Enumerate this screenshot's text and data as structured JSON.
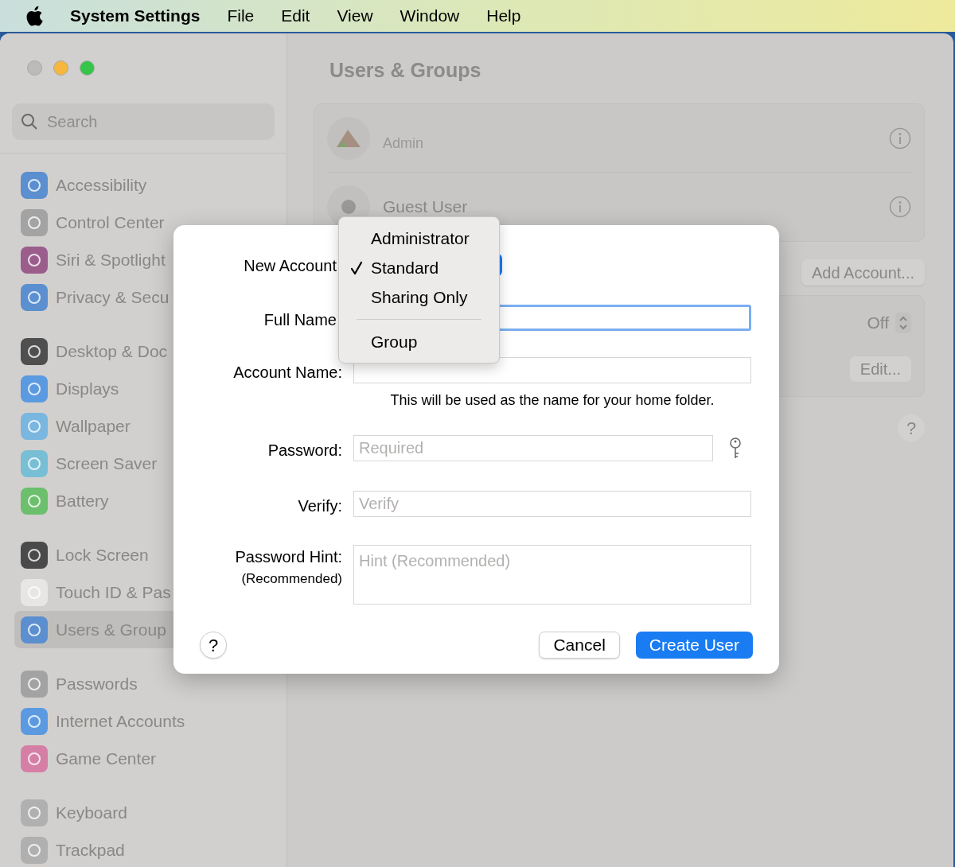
{
  "menu_bar": {
    "app": "System Settings",
    "menus": [
      "File",
      "Edit",
      "View",
      "Window",
      "Help"
    ]
  },
  "sidebar": {
    "search": {
      "placeholder": "Search"
    },
    "groups": [
      [
        {
          "label": "Accessibility",
          "color": "#5b8fcf",
          "selected": false
        },
        {
          "label": "Control Center",
          "color": "#a3a3a3",
          "selected": false
        },
        {
          "label": "Siri & Spotlight",
          "color": "#9b5d8c",
          "selected": false
        },
        {
          "label": "Privacy & Secu",
          "color": "#5b8fcf",
          "selected": false
        }
      ],
      [
        {
          "label": "Desktop & Doc",
          "color": "#4f4f4f",
          "selected": false
        },
        {
          "label": "Displays",
          "color": "#5b9ae0",
          "selected": false
        },
        {
          "label": "Wallpaper",
          "color": "#79b6e0",
          "selected": false
        },
        {
          "label": "Screen Saver",
          "color": "#78bfd6",
          "selected": false
        },
        {
          "label": "Battery",
          "color": "#6cbf6c",
          "selected": false
        }
      ],
      [
        {
          "label": "Lock Screen",
          "color": "#4a4a4a",
          "selected": false
        },
        {
          "label": "Touch ID & Pas",
          "color": "#e8e6e4",
          "selected": false
        },
        {
          "label": "Users & Group",
          "color": "#5b8fcf",
          "selected": true
        }
      ],
      [
        {
          "label": "Passwords",
          "color": "#a3a3a3",
          "selected": false
        },
        {
          "label": "Internet Accounts",
          "color": "#5b9ae0",
          "selected": false
        },
        {
          "label": "Game Center",
          "color": "#d57fa6",
          "selected": false
        }
      ],
      [
        {
          "label": "Keyboard",
          "color": "#b0b0b0",
          "selected": false
        },
        {
          "label": "Trackpad",
          "color": "#b0b0b0",
          "selected": false
        }
      ]
    ]
  },
  "content": {
    "title": "Users & Groups",
    "users": [
      {
        "kind": "admin",
        "subtitle": "Admin"
      },
      {
        "kind": "guest",
        "name": "Guest User"
      }
    ],
    "add_account_button": "Add Account...",
    "auto_login_value": "Off",
    "edit_button": "Edit...",
    "help_button": "?"
  },
  "dialog": {
    "fields": [
      {
        "kind": "popup",
        "label": "New Account"
      },
      {
        "kind": "text",
        "label": "Full Name",
        "focused": true
      },
      {
        "kind": "text",
        "label": "Account Name:",
        "focused": false,
        "note": "This will be used as the name for your home folder."
      },
      {
        "kind": "password",
        "label": "Password:",
        "placeholder": "Required"
      },
      {
        "kind": "text",
        "label": "Verify:",
        "placeholder": "Verify",
        "focused": false
      },
      {
        "kind": "textarea",
        "label": "Password Hint:",
        "sublabel": "(Recommended)",
        "placeholder": "Hint (Recommended)"
      }
    ],
    "help_button": "?",
    "cancel_button": "Cancel",
    "create_button": "Create User"
  },
  "popup_menu": [
    {
      "label": "Administrator",
      "selected": false
    },
    {
      "label": "Standard",
      "selected": true
    },
    {
      "label": "Sharing Only",
      "selected": false
    },
    {
      "kind": "separator"
    },
    {
      "label": "Group",
      "selected": false
    }
  ]
}
